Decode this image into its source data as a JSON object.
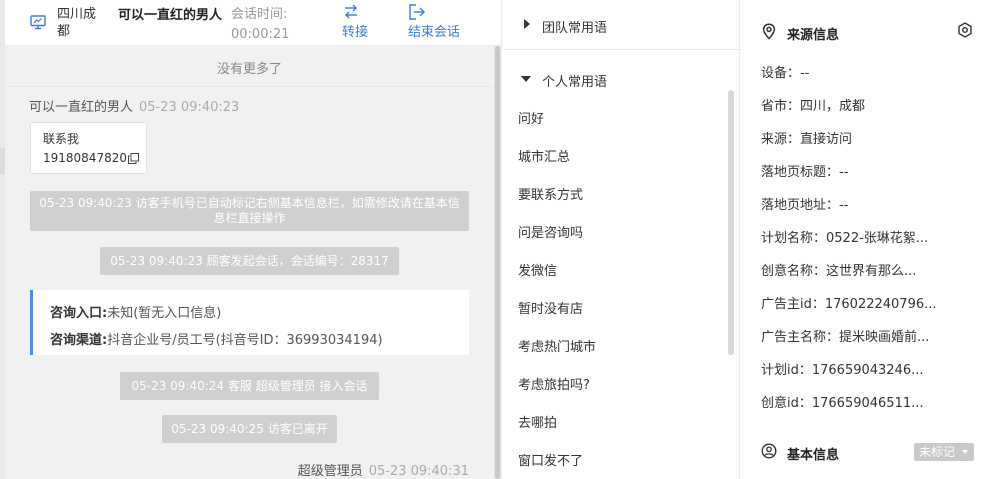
{
  "header": {
    "location": "四川成都",
    "visitor_name": "可以一直红的男人",
    "time_label": "会话时间:",
    "time_value": "00:00:21",
    "transfer_label": "转接",
    "end_label": "结束会话"
  },
  "chat": {
    "no_more": "没有更多了",
    "msg1": {
      "sender": "可以一直红的男人",
      "time": "05-23 09:40:23",
      "line1": "联系我",
      "line2": "19180847820"
    },
    "sys1": "05-23 09:40:23 访客手机号已自动标记右侧基本信息栏，如需修改请在基本信息栏直接操作",
    "sys2": "05-23 09:40:23 顾客发起会话，会话编号：28317",
    "consult": {
      "entry_key": "咨询入口:",
      "entry_val": "未知(暂无入口信息)",
      "channel_key": "咨询渠道:",
      "channel_val": "抖音企业号/员工号(抖音号ID：36993034194)"
    },
    "sys3": "05-23 09:40:24 客服 超级管理员 接入会话",
    "sys4": "05-23 09:40:25 访客已离开",
    "agent": {
      "name": "超级管理员",
      "time": "05-23 09:40:31"
    }
  },
  "phrases": {
    "team_group": "团队常用语",
    "personal_group": "个人常用语",
    "items": [
      "问好",
      "城市汇总",
      "要联系方式",
      "问是咨询吗",
      "发微信",
      "暂时没有店",
      "考虑热门城市",
      "考虑旅拍吗?",
      "去哪拍",
      "窗口发不了"
    ]
  },
  "info": {
    "source_title": "来源信息",
    "fields": [
      "设备：--",
      "省市：四川，成都",
      "来源：直接访问",
      "落地页标题：--",
      "落地页地址：--",
      "计划名称：0522-张琳花絮...",
      "创意名称：这世界有那么...",
      "广告主id：176022240796...",
      "广告主名称：提米映画婚前...",
      "计划id：176659043246...",
      "创意id：176659046511..."
    ],
    "basic_title": "基本信息",
    "tag_label": "未标记"
  },
  "colors": {
    "accent": "#3a7ae0",
    "info_border": "#4b8ef0",
    "system_bg": "#cfcfcf"
  }
}
